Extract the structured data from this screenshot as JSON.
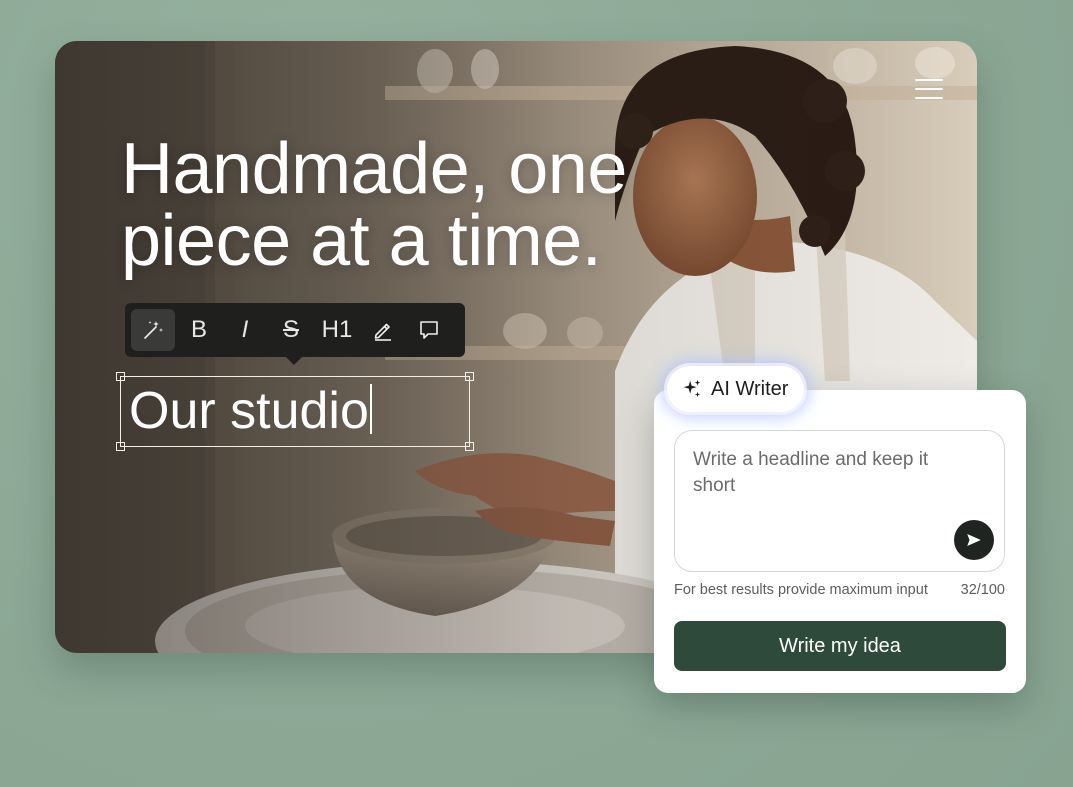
{
  "hero": {
    "headline_line1": "Handmade, one",
    "headline_line2": "piece at a time.",
    "editing_text": "Our studio"
  },
  "toolbar": {
    "items": [
      {
        "name": "ai-magic",
        "icon": "magic-wand-icon"
      },
      {
        "name": "bold",
        "label": "B"
      },
      {
        "name": "italic",
        "label": "I"
      },
      {
        "name": "strikethrough",
        "label": "S"
      },
      {
        "name": "heading",
        "label": "H1"
      },
      {
        "name": "edit",
        "icon": "pencil-icon"
      },
      {
        "name": "comment",
        "icon": "speech-bubble-icon"
      }
    ]
  },
  "ai_writer": {
    "pill_label": "AI Writer",
    "input_placeholder": "Write a headline and keep it short",
    "hint": "For best results provide maximum input",
    "counter": "32/100",
    "cta_label": "Write my idea"
  },
  "colors": {
    "background": "#8fab98",
    "cta": "#2d4a3a",
    "toolbar": "#1f1f1d"
  }
}
